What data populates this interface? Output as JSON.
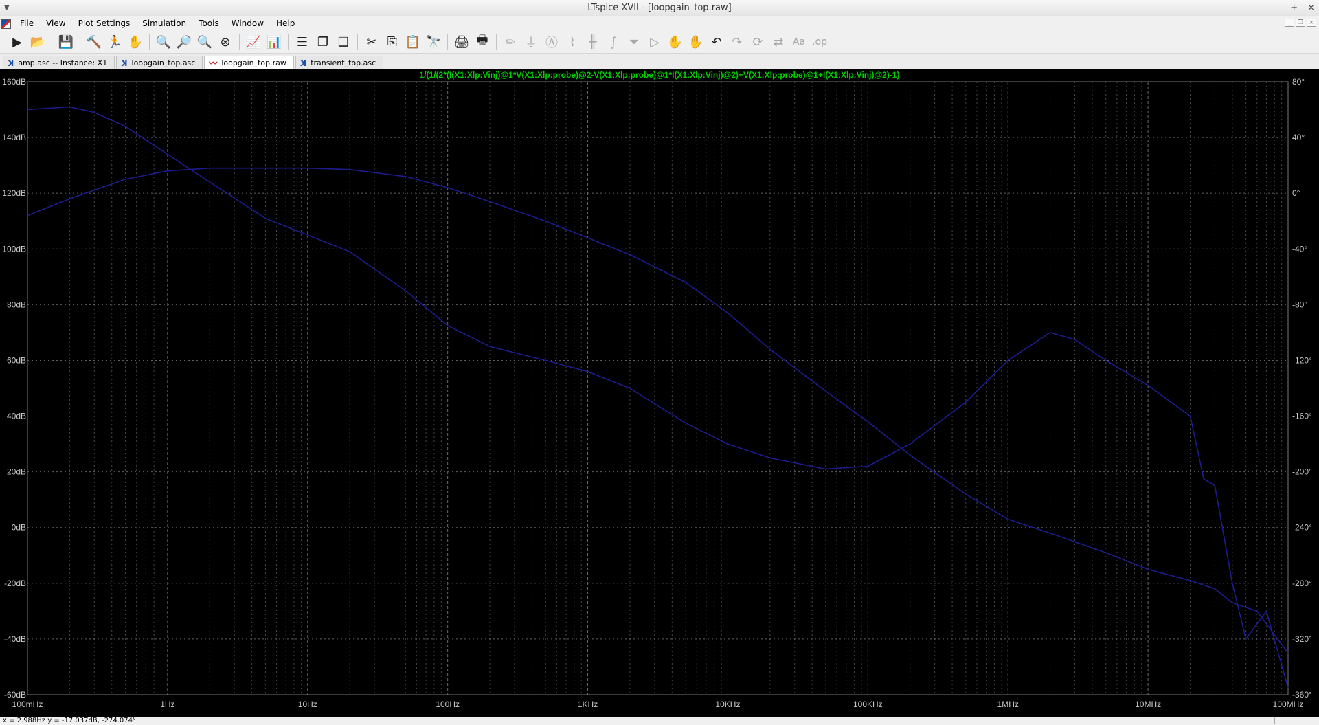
{
  "window": {
    "title": "LTspice XVII - [loopgain_top.raw]",
    "controls": [
      "–",
      "+",
      "×"
    ]
  },
  "menu": [
    "File",
    "View",
    "Plot Settings",
    "Simulation",
    "Tools",
    "Window",
    "Help"
  ],
  "toolbar": [
    {
      "icon": "run-icon",
      "glyph": "▶"
    },
    {
      "icon": "open-folder-icon",
      "glyph": "📂"
    },
    {
      "sep": true
    },
    {
      "icon": "save-icon",
      "glyph": "💾"
    },
    {
      "sep": true
    },
    {
      "icon": "control-panel-icon",
      "glyph": "🔨"
    },
    {
      "icon": "halt-icon",
      "glyph": "🏃"
    },
    {
      "icon": "pan-hand-icon",
      "glyph": "✋"
    },
    {
      "sep": true
    },
    {
      "icon": "zoom-in-icon",
      "glyph": "🔍"
    },
    {
      "icon": "zoom-area-icon",
      "glyph": "🔎"
    },
    {
      "icon": "zoom-out-icon",
      "glyph": "🔍"
    },
    {
      "icon": "zoom-fit-icon",
      "glyph": "⊗"
    },
    {
      "sep": true
    },
    {
      "icon": "autorange-icon",
      "glyph": "📈"
    },
    {
      "icon": "grid-icon",
      "glyph": "📊"
    },
    {
      "sep": true
    },
    {
      "icon": "tile-horizontal-icon",
      "glyph": "☰"
    },
    {
      "icon": "cascade-icon",
      "glyph": "❐"
    },
    {
      "icon": "tile-vertical-icon",
      "glyph": "❏"
    },
    {
      "sep": true
    },
    {
      "icon": "cut-icon",
      "glyph": "✂"
    },
    {
      "icon": "copy-icon",
      "glyph": "⎘"
    },
    {
      "icon": "paste-icon",
      "glyph": "📋"
    },
    {
      "icon": "find-icon",
      "glyph": "🔭"
    },
    {
      "sep": true
    },
    {
      "icon": "print-icon",
      "glyph": "🖨"
    },
    {
      "icon": "print-setup-icon",
      "glyph": "🖶"
    },
    {
      "sep": true
    },
    {
      "icon": "wire-icon",
      "glyph": "✏",
      "disabled": true
    },
    {
      "icon": "ground-icon",
      "glyph": "⏚",
      "disabled": true
    },
    {
      "icon": "label-net-icon",
      "glyph": "Ⓐ",
      "disabled": true
    },
    {
      "icon": "resistor-icon",
      "glyph": "⌇",
      "disabled": true
    },
    {
      "icon": "capacitor-icon",
      "glyph": "╫",
      "disabled": true
    },
    {
      "icon": "inductor-icon",
      "glyph": "∫",
      "disabled": true
    },
    {
      "icon": "diode-icon",
      "glyph": "⏷",
      "disabled": true
    },
    {
      "icon": "component-icon",
      "glyph": "▷",
      "disabled": true
    },
    {
      "icon": "move-icon",
      "glyph": "✋",
      "disabled": true
    },
    {
      "icon": "drag-icon",
      "glyph": "✋",
      "disabled": true
    },
    {
      "icon": "undo-icon",
      "glyph": "↶"
    },
    {
      "icon": "redo-icon",
      "glyph": "↷",
      "disabled": true
    },
    {
      "icon": "rotate-icon",
      "glyph": "⟳",
      "disabled": true
    },
    {
      "icon": "mirror-icon",
      "glyph": "⇄",
      "disabled": true
    },
    {
      "icon": "text-icon",
      "glyph": "Aa",
      "disabled": true
    },
    {
      "icon": "spice-directive-icon",
      "glyph": ".op",
      "disabled": true
    }
  ],
  "tabs": [
    {
      "label": "amp.asc -- Instance: X1",
      "type": "schematic",
      "active": false
    },
    {
      "label": "loopgain_top.asc",
      "type": "schematic",
      "active": false
    },
    {
      "label": "loopgain_top.raw",
      "type": "waveform",
      "active": true
    },
    {
      "label": "transient_top.asc",
      "type": "schematic",
      "active": false
    }
  ],
  "plot": {
    "trace_expression": "1/(1/(2*(I(X1:Xlp:Vinj)@1*V(X1:Xlp:probe)@2-V(X1:Xlp:probe)@1*I(X1:Xlp:Vinj)@2)+V(X1:Xlp:probe)@1+I(X1:Xlp:Vinj)@2)-1)",
    "colors": {
      "background": "#000000",
      "trace_label": "#00cc00",
      "trace": "#1d1d8f",
      "grid": "#777777",
      "axis_text": "#c8c8c8"
    }
  },
  "chart_data": {
    "type": "line",
    "title": "1/(1/(2*(I(X1:Xlp:Vinj)@1*V(X1:Xlp:probe)@2-V(X1:Xlp:probe)@1*I(X1:Xlp:Vinj)@2)+V(X1:Xlp:probe)@1+I(X1:Xlp:Vinj)@2)-1)",
    "xscale": "log",
    "xlim": [
      0.1,
      100000000
    ],
    "x_ticks": [
      0.1,
      1,
      10,
      100,
      1000,
      10000,
      100000,
      1000000,
      10000000,
      100000000
    ],
    "x_tick_labels": [
      "100mHz",
      "1Hz",
      "10Hz",
      "100Hz",
      "1KHz",
      "10KHz",
      "100KHz",
      "1MHz",
      "10MHz",
      "100MHz"
    ],
    "ylim_left": [
      -60,
      160
    ],
    "y_left_ticks": [
      160,
      140,
      120,
      100,
      80,
      60,
      40,
      20,
      0,
      -20,
      -40,
      -60
    ],
    "y_left_tick_labels": [
      "160dB",
      "140dB",
      "120dB",
      "100dB",
      "80dB",
      "60dB",
      "40dB",
      "20dB",
      "0dB",
      "-20dB",
      "-40dB",
      "-60dB"
    ],
    "ylim_right": [
      -360,
      80
    ],
    "y_right_ticks": [
      80,
      40,
      0,
      -40,
      -80,
      -120,
      -160,
      -200,
      -240,
      -280,
      -320,
      -360
    ],
    "y_right_tick_labels": [
      "80°",
      "40°",
      "0°",
      "-40°",
      "-80°",
      "-120°",
      "-160°",
      "-200°",
      "-240°",
      "-280°",
      "-320°",
      "-360°"
    ],
    "grid": true,
    "series": [
      {
        "axis": "left",
        "x": [
          0.1,
          0.2,
          0.5,
          1,
          2,
          5,
          10,
          20,
          50,
          100,
          200,
          500,
          1000,
          2000,
          5000,
          10000,
          20000,
          50000,
          100000,
          200000,
          500000,
          1000000,
          2000000,
          5000000,
          10000000,
          20000000,
          30000000,
          40000000,
          60000000,
          100000000
        ],
        "y": [
          112,
          118,
          125,
          128,
          129,
          129,
          129,
          128.5,
          126,
          122,
          117,
          110,
          104,
          98,
          88,
          77,
          64,
          49,
          38,
          26,
          12,
          3,
          -2,
          -9,
          -15,
          -19,
          -22,
          -27,
          -30,
          -45
        ]
      },
      {
        "axis": "right",
        "x": [
          0.1,
          0.2,
          0.3,
          0.5,
          1,
          2,
          5,
          10,
          20,
          50,
          100,
          200,
          500,
          1000,
          2000,
          5000,
          10000,
          20000,
          50000,
          100000,
          200000,
          500000,
          1000000,
          2000000,
          3000000,
          5000000,
          10000000,
          20000000,
          25000000,
          30000000,
          40000000,
          50000000,
          70000000,
          100000000
        ],
        "y": [
          60,
          62,
          58,
          48,
          28,
          8,
          -18,
          -30,
          -42,
          -70,
          -95,
          -110,
          -120,
          -128,
          -140,
          -165,
          -180,
          -190,
          -198,
          -196,
          -180,
          -150,
          -120,
          -100,
          -105,
          -120,
          -138,
          -160,
          -205,
          -210,
          -280,
          -320,
          -300,
          -355
        ]
      }
    ]
  },
  "status": {
    "readout": "x = 2.988Hz    y = -17.037dB, -274.074°"
  }
}
